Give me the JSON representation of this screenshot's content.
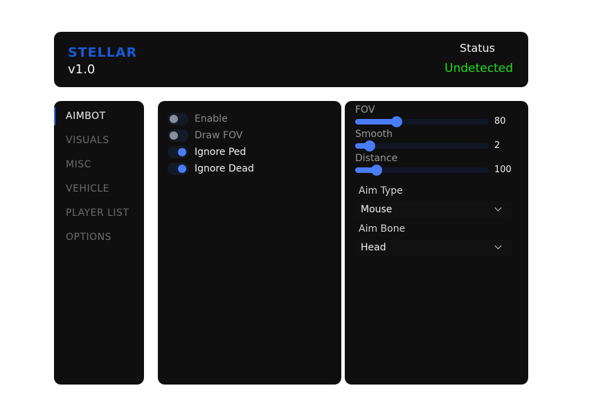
{
  "header": {
    "brand": "STELLAR",
    "version": "v1.0",
    "status_label": "Status",
    "status_value": "Undetected"
  },
  "colors": {
    "brand": "#1a5ad6",
    "status_ok": "#1ee01e",
    "accent": "#4a7cf7",
    "panel_bg": "#0f0f0f"
  },
  "sidebar": {
    "items": [
      {
        "label": "AIMBOT",
        "active": true
      },
      {
        "label": "VISUALS",
        "active": false
      },
      {
        "label": "MISC",
        "active": false
      },
      {
        "label": "VEHICLE",
        "active": false
      },
      {
        "label": "PLAYER LIST",
        "active": false
      },
      {
        "label": "OPTIONS",
        "active": false
      }
    ]
  },
  "toggles": [
    {
      "label": "Enable",
      "on": false
    },
    {
      "label": "Draw FOV",
      "on": false
    },
    {
      "label": "Ignore Ped",
      "on": true
    },
    {
      "label": "Ignore Dead",
      "on": true
    }
  ],
  "sliders": [
    {
      "label": "FOV",
      "value": "80",
      "fraction": 0.31
    },
    {
      "label": "Smooth",
      "value": "2",
      "fraction": 0.11
    },
    {
      "label": "Distance",
      "value": "100",
      "fraction": 0.16
    }
  ],
  "selects": [
    {
      "label": "Aim Type",
      "value": "Mouse"
    },
    {
      "label": "Aim Bone",
      "value": "Head"
    }
  ]
}
